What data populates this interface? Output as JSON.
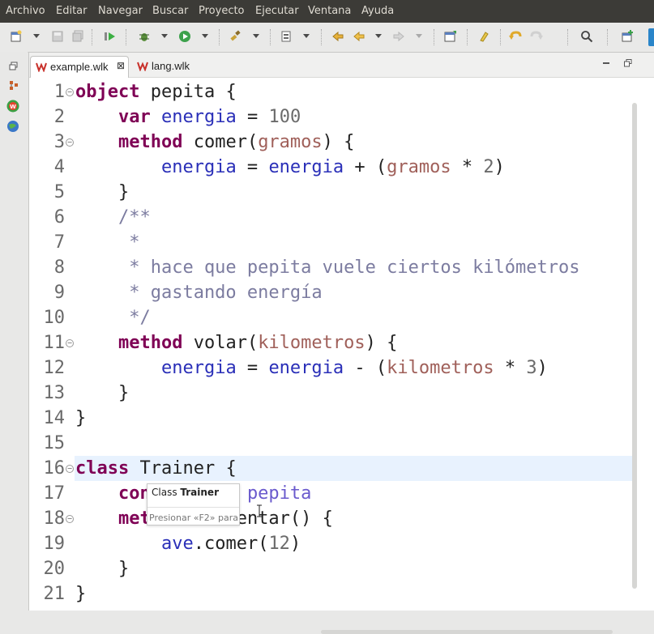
{
  "menu": [
    "Archivo",
    "Editar",
    "Navegar",
    "Buscar",
    "Proyecto",
    "Ejecutar",
    "Ventana",
    "Ayuda"
  ],
  "tabs": [
    {
      "label": "example.wlk",
      "active": true,
      "close": "⊠"
    },
    {
      "label": "lang.wlk",
      "active": false
    }
  ],
  "editor": {
    "line_numbers": [
      "1",
      "2",
      "3",
      "4",
      "5",
      "6",
      "7",
      "8",
      "9",
      "10",
      "11",
      "12",
      "13",
      "14",
      "15",
      "16",
      "17",
      "18",
      "19",
      "20",
      "21"
    ],
    "current_line": "15"
  },
  "tooltip": {
    "prefix": "Class ",
    "name": "Trainer",
    "hint": "Presionar «F2» para"
  },
  "colors": {
    "keyword": "#7f0055",
    "variable": "#2a2fb8",
    "parameter": "#a0605a",
    "comment": "#7c7ca0",
    "current_line": "#e8f2fe"
  }
}
